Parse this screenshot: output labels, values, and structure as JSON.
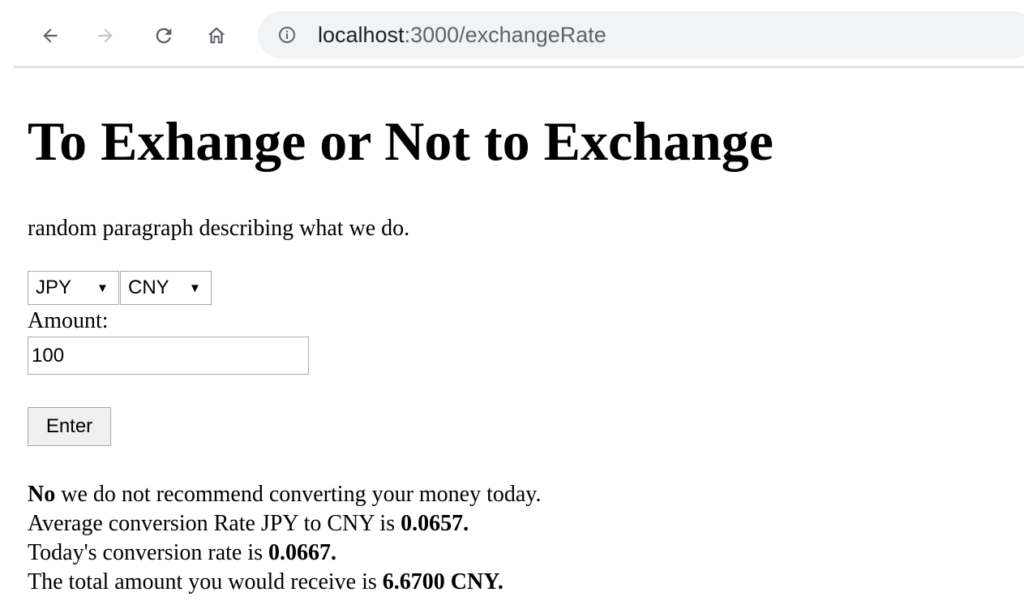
{
  "browser": {
    "nav_icons": [
      "back-arrow-icon",
      "forward-arrow-icon",
      "reload-icon",
      "home-icon"
    ],
    "info_icon": "info-icon",
    "url_host": "localhost",
    "url_path": ":3000/exchangeRate",
    "colors": {
      "omnibox_bg": "#f1f3f4",
      "url_path": "#5f6368",
      "icon_active": "#5f6368",
      "icon_disabled": "#c4c7ca"
    }
  },
  "page": {
    "title": "To Exhange or Not to Exchange",
    "description": "random paragraph describing what we do.",
    "form": {
      "from_currency": "JPY",
      "to_currency": "CNY",
      "caret": "▼",
      "amount_label": "Amount:",
      "amount_value": "100",
      "submit_label": "Enter"
    },
    "result": {
      "line1_bold": "No",
      "line1_rest": " we do not recommend converting your money today.",
      "line2_text": "Average conversion Rate JPY to CNY is ",
      "line2_bold": "0.0657.",
      "line3_text": "Today's conversion rate is ",
      "line3_bold": "0.0667.",
      "line4_text": "The total amount you would receive is ",
      "line4_bold": "6.6700 CNY."
    }
  }
}
